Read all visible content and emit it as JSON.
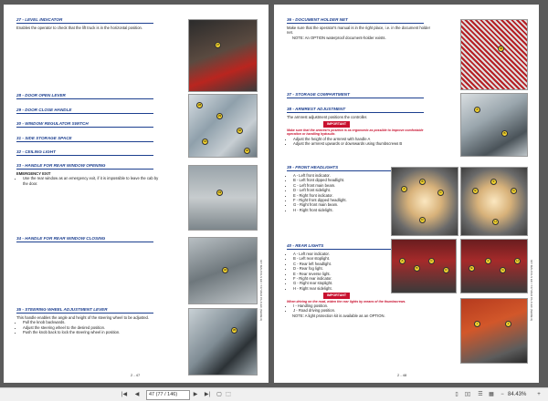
{
  "left_page": {
    "sections": [
      {
        "title": "27 - LEVEL INDICATOR",
        "body": "Enables the operator to check that the lift truck is in the horizontal position."
      },
      {
        "title": "28 - DOOR OPEN LEVER"
      },
      {
        "title": "29 - DOOR CLOSE HANDLE"
      },
      {
        "title": "30 - WINDOW REGULATOR SWITCH"
      },
      {
        "title": "31 - SIDE STORAGE SPACE"
      },
      {
        "title": "32 - CEILING LIGHT"
      },
      {
        "title": "33 - HANDLE FOR REAR WINDOW OPENING",
        "subheading": "EMERGENCY EXIT",
        "bullets": [
          "Use the rear window as an emergency exit, if it is impossible to leave the cab by the door."
        ]
      },
      {
        "title": "34 - HANDLE FOR REAR WINDOW CLOSING"
      },
      {
        "title": "35 - STEERING WHEEL ADJUSTMENT LEVER",
        "body": "This handle enables the angle and height of the steering wheel to be adjusted.",
        "bullets": [
          "Pull the knob backwards.",
          "Adjust the steering wheel to the desired position.",
          "Push the knob back to lock the steering wheel in position."
        ]
      }
    ],
    "page_number": "2 - 47",
    "side_text": "647 MAU PA-S EC / 747 MAU PA-S EC (SERIE 6)"
  },
  "right_page": {
    "sections": [
      {
        "title": "36 - DOCUMENT HOLDER NET",
        "body": "Make sure that the operator's manual is in the right place, i.e. in the document holder net.",
        "note": "NOTE: An OPTION waterproof document-holder exists."
      },
      {
        "title": "37 - STORAGE COMPARTMENT"
      },
      {
        "title": "38 - ARMREST ADJUSTMENT",
        "body": "The armrest adjustment positions the controller.",
        "badge": "IMPORTANT",
        "warning": "Make sure that the armrest's position is as ergonomic as possible to improve comfortable operation or handling hydraulic.",
        "bullets": [
          "Adjust the height of the armrest with handle A",
          "Adjust the armrest upwards or downwards using thumbscrews B"
        ]
      },
      {
        "title": "39 - FRONT HEADLIGHTS",
        "bullets": [
          "A - Left front indicator.",
          "B - Left front dipped headlight.",
          "C - Left front main beam.",
          "D - Left front sidelight.",
          "E - Right front indicator.",
          "F - Right front dipped headlight.",
          "G - Right front main beam.",
          "H - Right front sidelight."
        ]
      },
      {
        "title": "40 - REAR LIGHTS",
        "bullets": [
          "A - Left rear indicator.",
          "B - Left rear stoplight.",
          "C - Rear left headlight.",
          "D - Rear fog light.",
          "E - Rear reverse light.",
          "F - Right rear indicator.",
          "G - Right rear stoplight.",
          "H - Right rear sidelight."
        ],
        "badge": "IMPORTANT",
        "warning": "When driving on the road, widen the rear lights by means of the thumbscrews.",
        "bullets2": [
          "I - Handling position.",
          "J - Road driving position."
        ],
        "note": "NOTE: A light protection kit is available as an OPTION."
      }
    ],
    "page_number": "2 - 48",
    "side_text": "647 MAU PA-S EC / 747 MAU PA-S EC (SERIE 6)"
  },
  "toolbar": {
    "page_value": "47 (77 / 146)",
    "zoom": "84.43%"
  },
  "colors": {
    "title_blue": "#1c3f8f",
    "warning_red": "#c8102e",
    "callout_yellow": "#f2d22e"
  }
}
